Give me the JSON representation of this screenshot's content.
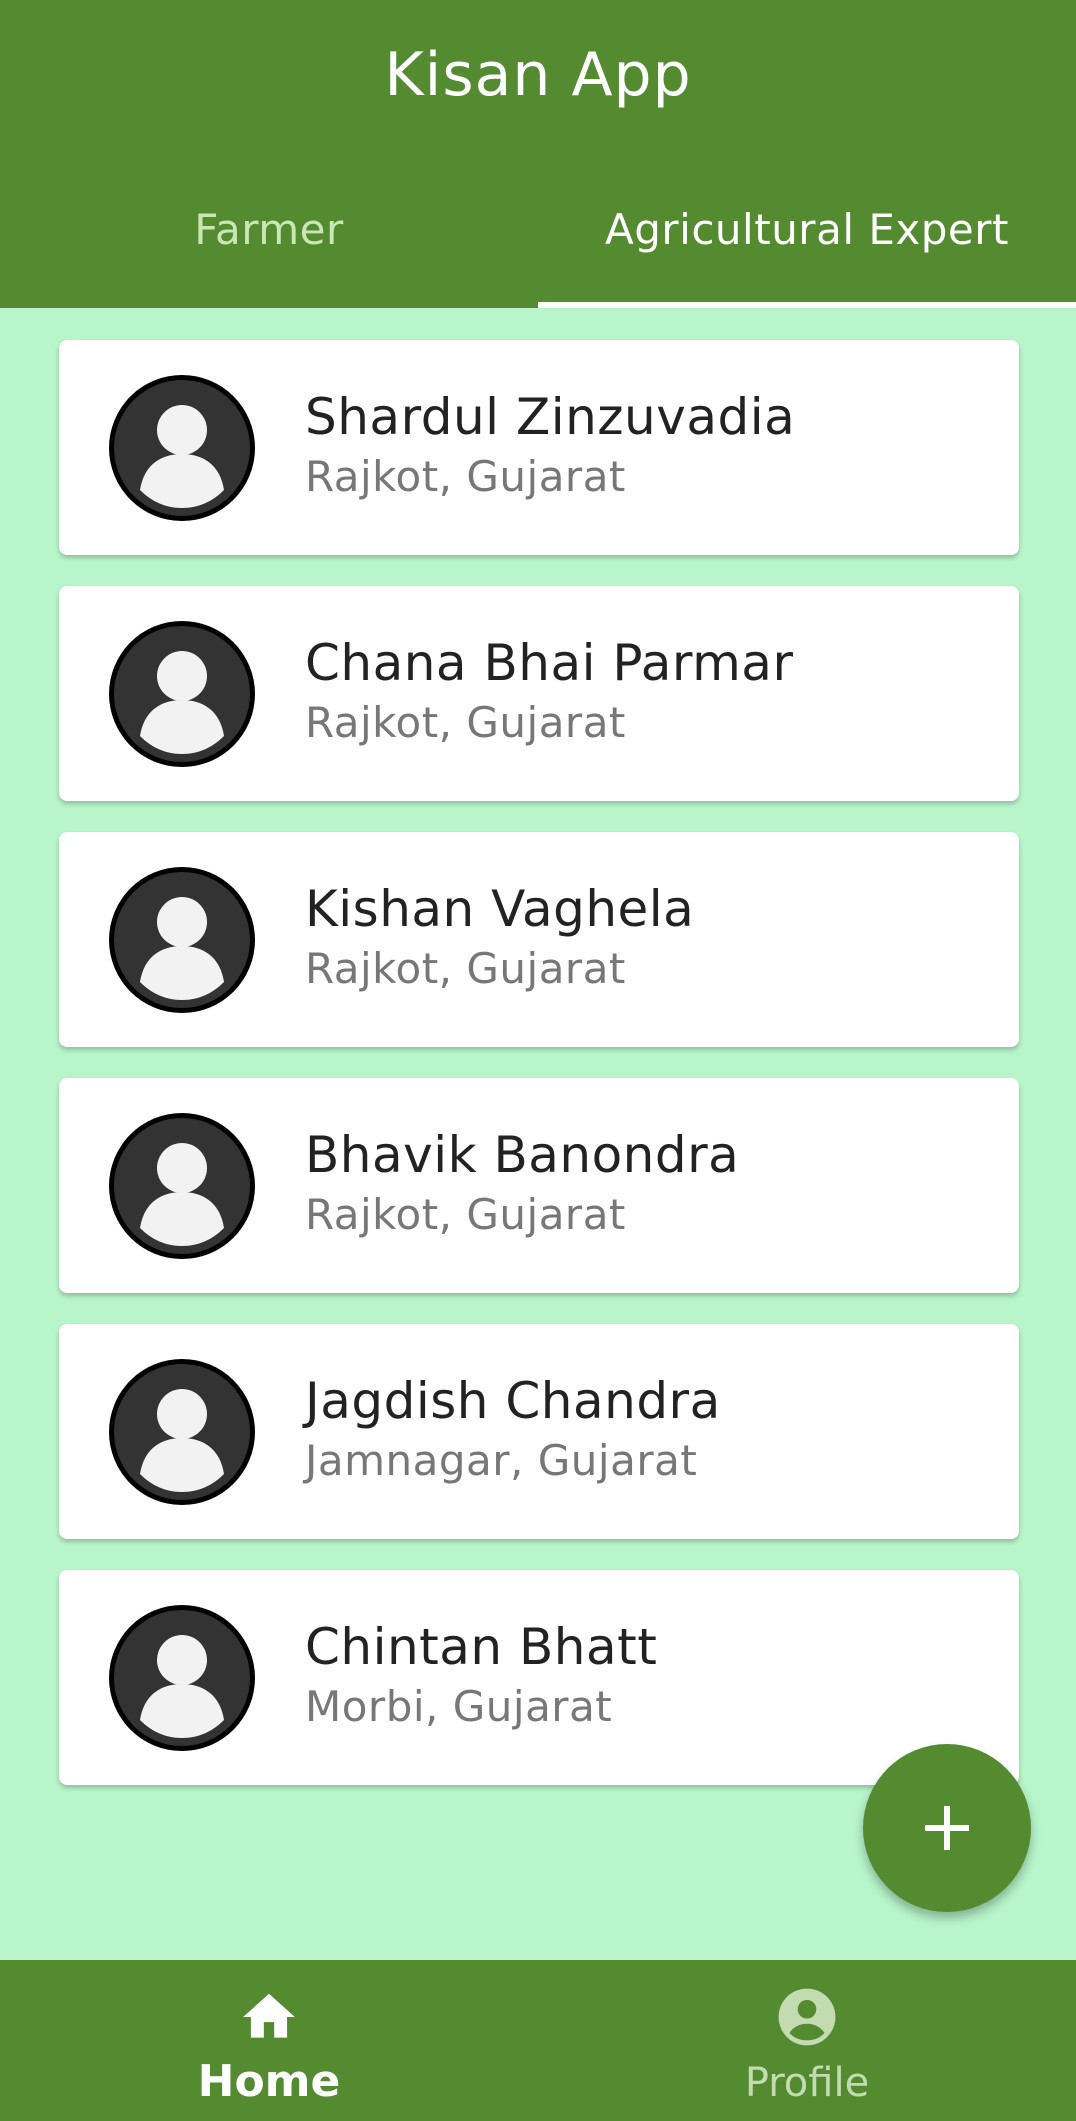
{
  "app": {
    "title": "Kisan App"
  },
  "tabs": [
    {
      "label": "Farmer",
      "selected": false
    },
    {
      "label": "Agricultural Expert",
      "selected": true
    }
  ],
  "experts": [
    {
      "name": "Shardul Zinzuvadia",
      "location": "Rajkot, Gujarat"
    },
    {
      "name": "Chana Bhai Parmar",
      "location": "Rajkot, Gujarat"
    },
    {
      "name": "Kishan Vaghela",
      "location": "Rajkot, Gujarat"
    },
    {
      "name": "Bhavik Banondra",
      "location": "Rajkot, Gujarat"
    },
    {
      "name": "Jagdish Chandra",
      "location": "Jamnagar, Gujarat"
    },
    {
      "name": "Chintan Bhatt",
      "location": "Morbi, Gujarat"
    }
  ],
  "fab": {
    "icon": "plus-icon"
  },
  "bottom_nav": [
    {
      "label": "Home",
      "icon": "home-icon",
      "active": true
    },
    {
      "label": "Profile",
      "icon": "profile-icon",
      "active": false
    }
  ],
  "colors": {
    "primary": "#548b30",
    "background": "#b8f5cb",
    "card": "#ffffff",
    "avatar": "#333333"
  }
}
